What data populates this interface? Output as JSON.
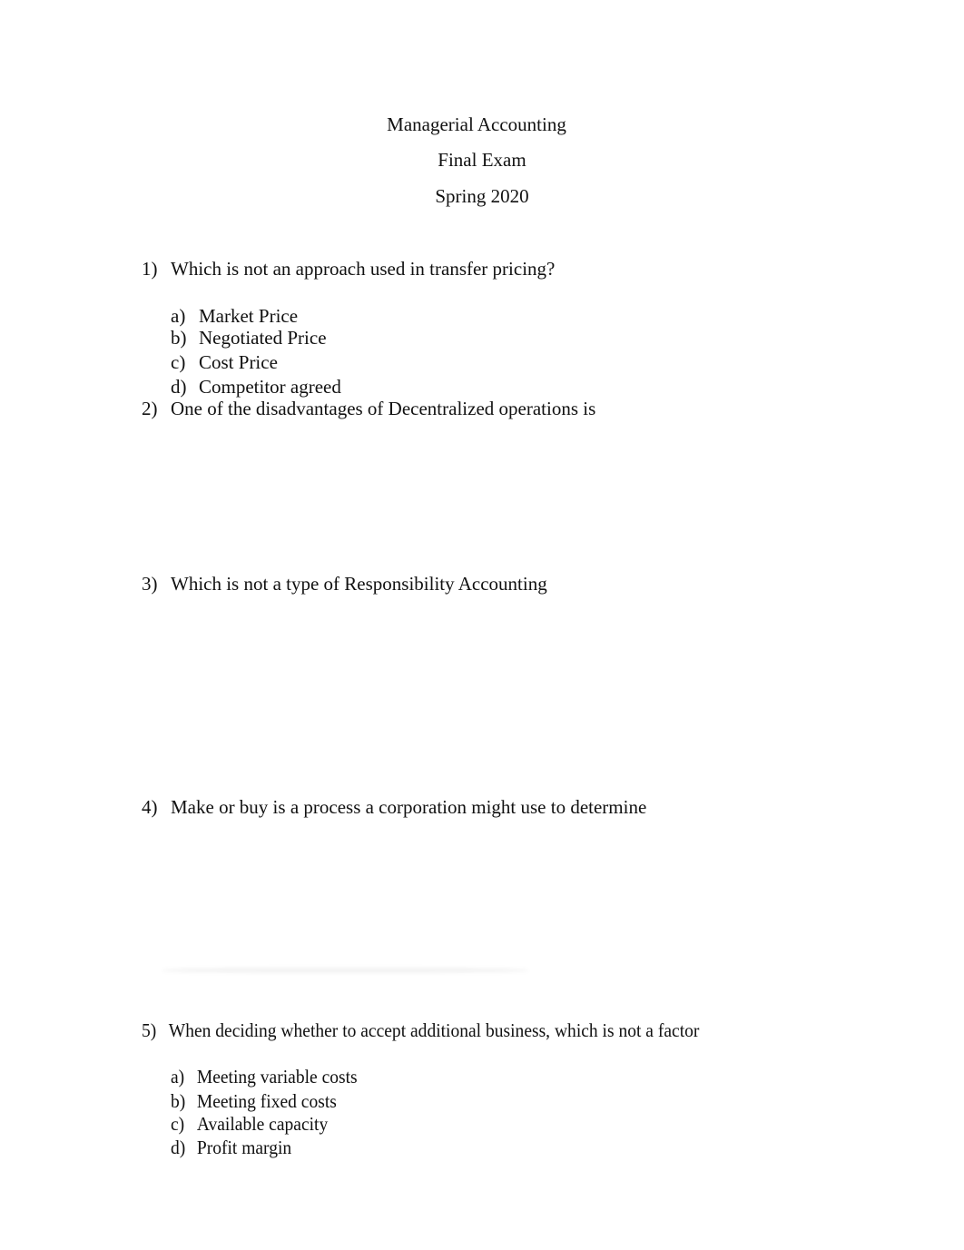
{
  "header": {
    "course": "Managerial Accounting",
    "exam": "Final Exam",
    "term": "Spring 2020"
  },
  "questions": [
    {
      "number": "1)",
      "text": "Which is not an approach used in transfer pricing?",
      "options": [
        {
          "letter": "a)",
          "text": "Market Price"
        },
        {
          "letter": "b)",
          "text": "Negotiated Price"
        },
        {
          "letter": "c)",
          "text": "Cost Price"
        },
        {
          "letter": "d)",
          "text": "Competitor agreed"
        }
      ]
    },
    {
      "number": "2)",
      "text": "One of the disadvantages of Decentralized operations is",
      "options": []
    },
    {
      "number": "3)",
      "text": "Which is not a type of Responsibility Accounting",
      "options": []
    },
    {
      "number": "4)",
      "text": "Make or buy is a process a corporation might use to determine",
      "options": []
    },
    {
      "number": "5)",
      "text": "When deciding whether to accept additional business, which is not a factor",
      "options": [
        {
          "letter": "a)",
          "text": "Meeting variable costs"
        },
        {
          "letter": "b)",
          "text": "Meeting fixed costs"
        },
        {
          "letter": "c)",
          "text": "Available capacity"
        },
        {
          "letter": "d)",
          "text": "Profit margin"
        }
      ]
    }
  ]
}
